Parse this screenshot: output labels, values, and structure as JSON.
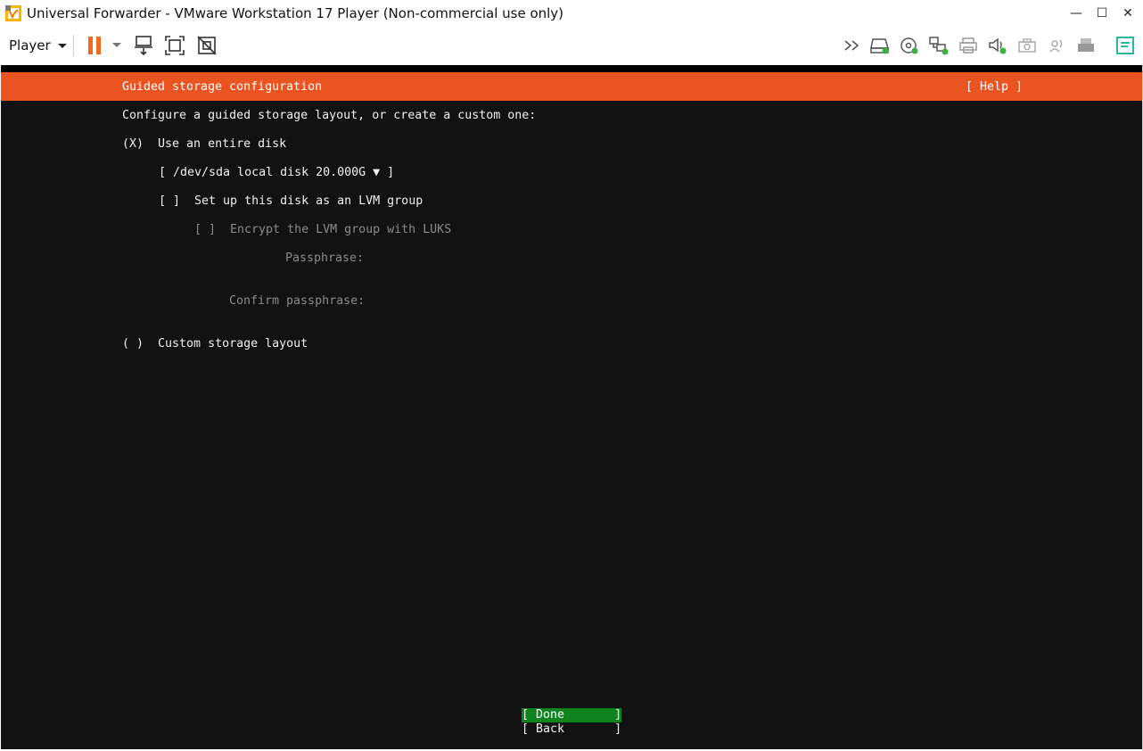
{
  "window": {
    "title": "Universal Forwarder - VMware Workstation 17 Player (Non-commercial use only)",
    "minimize_glyph": "—",
    "maximize_glyph": "☐",
    "close_glyph": "✕"
  },
  "toolbar": {
    "player_label": "Player",
    "icons_left": [
      "pause-icon",
      "dropdown-caret-icon",
      "send-ctrl-alt-del-icon",
      "full-screen-icon",
      "unity-icon"
    ],
    "icons_right": [
      "more-devices-icon",
      "hard-disk-icon",
      "cd-dvd-icon",
      "network-adapter-icon",
      "printer-icon",
      "sound-card-icon",
      "camera-icon",
      "usb-device-icon",
      "printer-disabled-icon",
      "message-log-icon"
    ]
  },
  "installer": {
    "header_title": "Guided storage configuration",
    "help_label": "[ Help ]",
    "intro": "Configure a guided storage layout, or create a custom one:",
    "entire_disk_radio": "(X)  Use an entire disk",
    "disk_select": "[ /dev/sda local disk 20.000G ▼ ]",
    "lvm_checkbox": "[ ]  Set up this disk as an LVM group",
    "encrypt_checkbox": "[ ]  Encrypt the LVM group with LUKS",
    "passphrase_label": "Passphrase:",
    "confirm_passphrase_label": "Confirm passphrase:",
    "custom_radio": "( )  Custom storage layout",
    "done_button": "[ Done       ]",
    "back_button": "[ Back       ]"
  },
  "colors": {
    "accent": "#e95420",
    "selected_button": "#0e8420",
    "terminal_bg": "#121212",
    "pause_orange": "#f26b1d"
  }
}
